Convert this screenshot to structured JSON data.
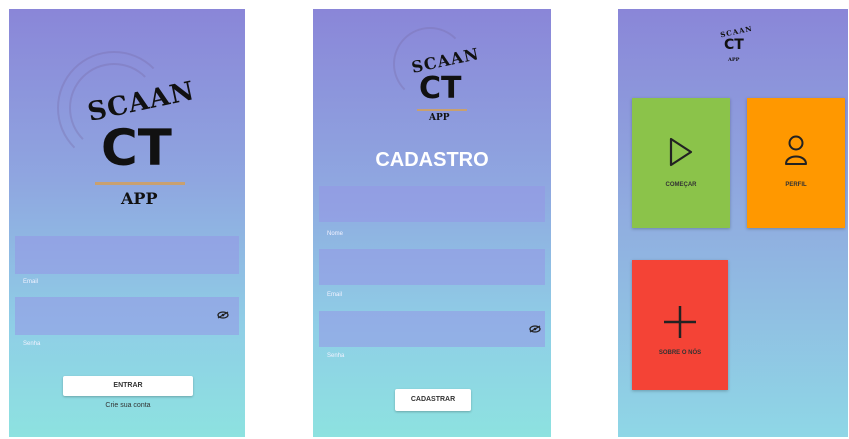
{
  "login": {
    "logo": {
      "scan": "SCAAN",
      "ct": "CT",
      "app": "APP"
    },
    "email_label": "Email",
    "password_label": "Senha",
    "submit_label": "ENTRAR",
    "create_account_link": "Crie sua conta"
  },
  "register": {
    "logo": {
      "scan": "SCAAN",
      "ct": "CT",
      "app": "APP"
    },
    "title": "CADASTRO",
    "name_label": "Nome",
    "email_label": "Email",
    "password_label": "Senha",
    "submit_label": "CADASTRAR"
  },
  "home": {
    "logo": {
      "scan": "SCAAN",
      "ct": "CT",
      "app": "APP"
    },
    "tiles": [
      {
        "label": "COMEÇAR",
        "icon": "play-icon",
        "color": "#8bc34a"
      },
      {
        "label": "PERFIL",
        "icon": "user-icon",
        "color": "#ff9800"
      },
      {
        "label": "SOBRE O NÓS",
        "icon": "plus-icon",
        "color": "#f44336"
      }
    ]
  }
}
